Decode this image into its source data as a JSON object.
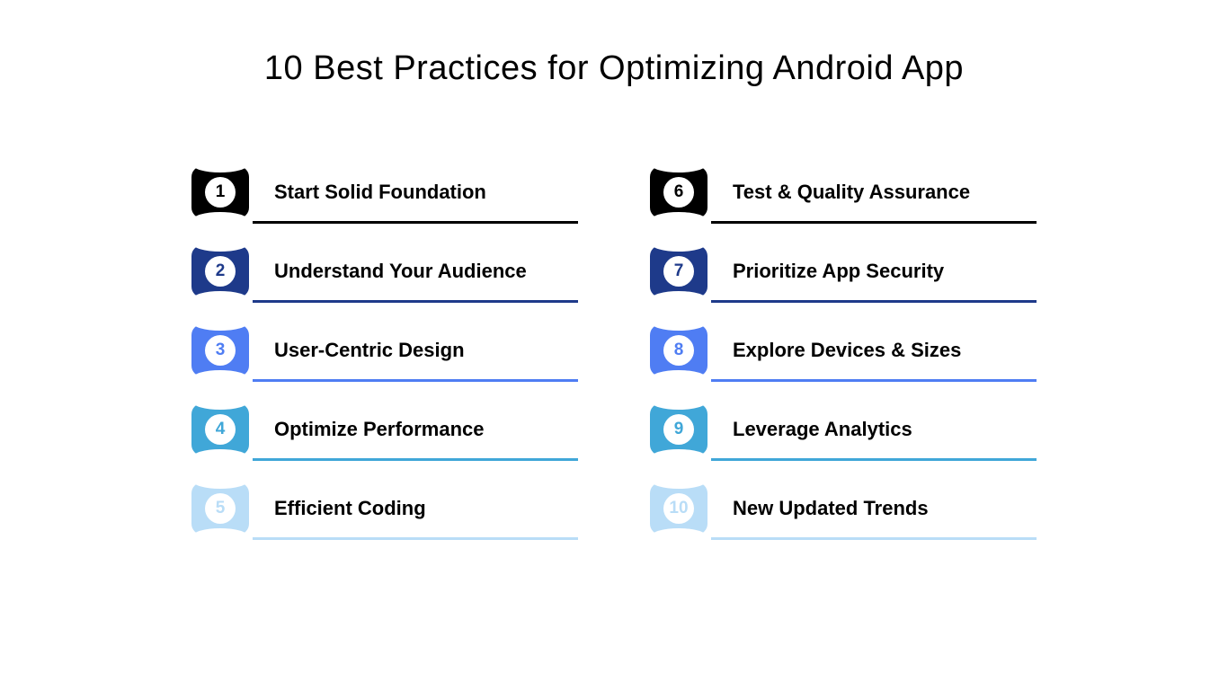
{
  "title": "10 Best Practices for Optimizing Android App",
  "columns": [
    [
      {
        "num": "1",
        "label": "Start Solid Foundation",
        "bg": "#000000",
        "fg": "#000000",
        "rule": "#000000"
      },
      {
        "num": "2",
        "label": "Understand Your Audience",
        "bg": "#1e3a8a",
        "fg": "#1e3a8a",
        "rule": "#1e3a8a"
      },
      {
        "num": "3",
        "label": "User-Centric Design",
        "bg": "#4f7df3",
        "fg": "#4f7df3",
        "rule": "#4f7df3"
      },
      {
        "num": "4",
        "label": "Optimize Performance",
        "bg": "#40a7d8",
        "fg": "#40a7d8",
        "rule": "#40a7d8"
      },
      {
        "num": "5",
        "label": "Efficient Coding",
        "bg": "#b9ddf7",
        "fg": "#b9ddf7",
        "rule": "#b9ddf7"
      }
    ],
    [
      {
        "num": "6",
        "label": "Test & Quality Assurance",
        "bg": "#000000",
        "fg": "#000000",
        "rule": "#000000"
      },
      {
        "num": "7",
        "label": "Prioritize App Security",
        "bg": "#1e3a8a",
        "fg": "#1e3a8a",
        "rule": "#1e3a8a"
      },
      {
        "num": "8",
        "label": "Explore Devices &  Sizes",
        "bg": "#4f7df3",
        "fg": "#4f7df3",
        "rule": "#4f7df3"
      },
      {
        "num": "9",
        "label": "Leverage Analytics",
        "bg": "#40a7d8",
        "fg": "#40a7d8",
        "rule": "#40a7d8"
      },
      {
        "num": "10",
        "label": "New Updated Trends",
        "bg": "#b9ddf7",
        "fg": "#b9ddf7",
        "rule": "#b9ddf7"
      }
    ]
  ]
}
